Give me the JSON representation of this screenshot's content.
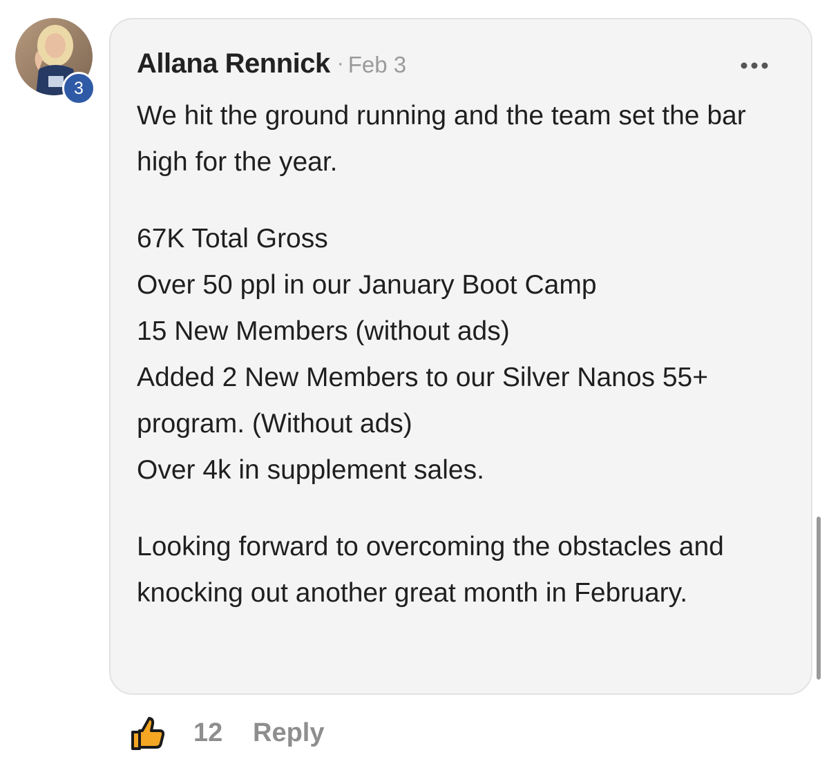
{
  "post": {
    "author": "Allana Rennick",
    "separator": "·",
    "date": "Feb 3",
    "level": "3",
    "body": {
      "intro": "We hit the ground running and the team set the bar high for the year.",
      "stats": [
        "67K Total Gross",
        "Over 50 ppl in our January Boot Camp",
        "15 New Members (without ads)",
        "Added 2 New Members to our Silver Nanos 55+ program. (Without ads)",
        "Over 4k in supplement sales."
      ],
      "closing": "Looking forward to overcoming the obstacles and knocking out another great month in February."
    }
  },
  "actions": {
    "like_count": "12",
    "reply_label": "Reply"
  },
  "icons": {
    "more": "more-horizontal-icon",
    "like": "thumbs-up-icon"
  },
  "colors": {
    "card_bg": "#f4f4f4",
    "badge": "#2f5aa6",
    "muted_text": "#8e8e8e"
  }
}
